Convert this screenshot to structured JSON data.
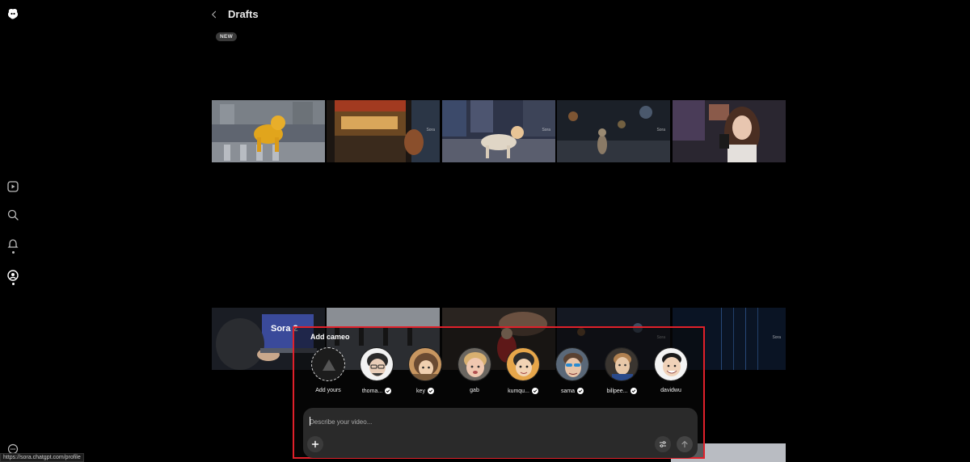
{
  "header": {
    "title": "Drafts",
    "badge": "NEW"
  },
  "sidebar": {
    "items": [
      {
        "icon": "logo-icon"
      },
      {
        "icon": "play-icon"
      },
      {
        "icon": "search-icon"
      },
      {
        "icon": "bell-icon"
      },
      {
        "icon": "profile-icon"
      },
      {
        "icon": "more-icon"
      }
    ]
  },
  "tiles": {
    "watermark": "Sora",
    "banner_text": "Sora 2"
  },
  "cameo_panel": {
    "title": "Add cameo",
    "cameos": [
      {
        "name": "Add yours",
        "verified": false
      },
      {
        "name": "thoma...",
        "verified": true
      },
      {
        "name": "key",
        "verified": true
      },
      {
        "name": "gab",
        "verified": false
      },
      {
        "name": "kumqu...",
        "verified": true
      },
      {
        "name": "sama",
        "verified": true
      },
      {
        "name": "billpee...",
        "verified": true
      },
      {
        "name": "davidwu",
        "verified": false
      }
    ]
  },
  "composer": {
    "placeholder": "Describe your video...",
    "add_button_icon": "plus-icon",
    "settings_button_icon": "sliders-icon",
    "submit_button_icon": "arrow-up-icon"
  },
  "status_bar": {
    "url": "https://sora.chatgpt.com/profile"
  },
  "colors": {
    "background": "#000000",
    "highlight_border": "#e0202a",
    "composer_bg": "#2a2a2a"
  }
}
